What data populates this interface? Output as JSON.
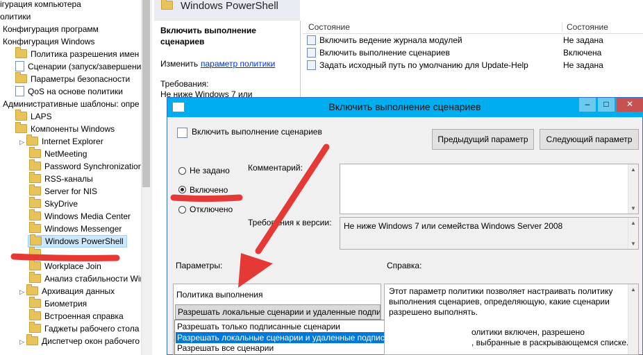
{
  "tree": {
    "items": [
      {
        "label": "ігурация компьютера",
        "icon": "none"
      },
      {
        "label": "олитики",
        "icon": "none"
      },
      {
        "label": "Конфигурация программ",
        "icon": "none"
      },
      {
        "label": "Конфигурация Windows",
        "icon": "none"
      },
      {
        "label": "Политика разрешения имен",
        "icon": "folder"
      },
      {
        "label": "Сценарии (запуск/завершение)",
        "icon": "doc"
      },
      {
        "label": "Параметры безопасности",
        "icon": "folder"
      },
      {
        "label": "QoS на основе политики",
        "icon": "chart"
      },
      {
        "label": "Административные шаблоны: опре",
        "icon": "none"
      },
      {
        "label": "LAPS",
        "icon": "folder"
      },
      {
        "label": "Компоненты Windows",
        "icon": "folder"
      },
      {
        "label": "Internet Explorer",
        "icon": "folder"
      },
      {
        "label": "NetMeeting",
        "icon": "folder"
      },
      {
        "label": "Password Synchronization",
        "icon": "folder"
      },
      {
        "label": "RSS-каналы",
        "icon": "folder"
      },
      {
        "label": "Server for NIS",
        "icon": "folder"
      },
      {
        "label": "SkyDrive",
        "icon": "folder"
      },
      {
        "label": "Windows Media Center",
        "icon": "folder"
      },
      {
        "label": "Windows Messenger",
        "icon": "folder"
      },
      {
        "label": "Windows PowerShell",
        "icon": "folder"
      },
      {
        "label": "",
        "icon": "folder"
      },
      {
        "label": "Workplace Join",
        "icon": "folder"
      },
      {
        "label": "Анализ стабильности Window",
        "icon": "folder"
      },
      {
        "label": "Архивация данных",
        "icon": "folder"
      },
      {
        "label": "Биометрия",
        "icon": "folder"
      },
      {
        "label": "Встроенная справка",
        "icon": "folder"
      },
      {
        "label": "Гаджеты рабочего стола",
        "icon": "folder"
      },
      {
        "label": "Диспетчер окон рабочего ст",
        "icon": "folder"
      }
    ]
  },
  "header": {
    "title": "Windows PowerShell"
  },
  "description": {
    "title_line1": "Включить выполнение",
    "title_line2": "сценариев",
    "edit_prefix": "Изменить",
    "edit_link": "параметр политики",
    "requirements_label": "Требования:",
    "requirements_text": "Не ниже Windows 7 или"
  },
  "list": {
    "col_setting": "Состояние",
    "col_state": "Состояние",
    "rows": [
      {
        "name": "Включить ведение журнала модулей",
        "state": "Не задана"
      },
      {
        "name": "Включить выполнение сценариев",
        "state": "Включена"
      },
      {
        "name": "Задать исходный путь по умолчанию для Update-Help",
        "state": "Не задана"
      }
    ]
  },
  "dialog": {
    "title": "Включить выполнение сценариев",
    "minimize": "–",
    "maximize": "□",
    "close": "✕",
    "setting_name": "Включить выполнение сценариев",
    "prev_button": "Предыдущий параметр",
    "next_button": "Следующий параметр",
    "radio_not_configured": "Не задано",
    "radio_enabled": "Включено",
    "radio_disabled": "Отключено",
    "comment_label": "Комментарий:",
    "supported_label": "Требования к версии:",
    "supported_text": "Не ниже Windows 7 или семейства Windows Server 2008",
    "options_label": "Параметры:",
    "help_label": "Справка:",
    "policy_label": "Политика выполнения",
    "select_value": "Разрешать локальные сценарии и удаленные подпис",
    "dropdown_options": [
      "Разрешать только подписанные сценарии",
      "Разрешать локальные сценарии и удаленные подписанные сценарии",
      "Разрешать все сценарии"
    ],
    "help_line1": "Этот параметр политики позволяет настраивать политику",
    "help_line2": "выполнения сценариев, определяющую, какие сценарии",
    "help_line3": "разрешено выполнять.",
    "help_line4": "олитики включен, разрешено",
    "help_line5": ", выбранные в раскрывающемся списке."
  },
  "colors": {
    "annotation": "#e53935",
    "titlebar": "#00aeef",
    "selection": "#0078d7"
  }
}
